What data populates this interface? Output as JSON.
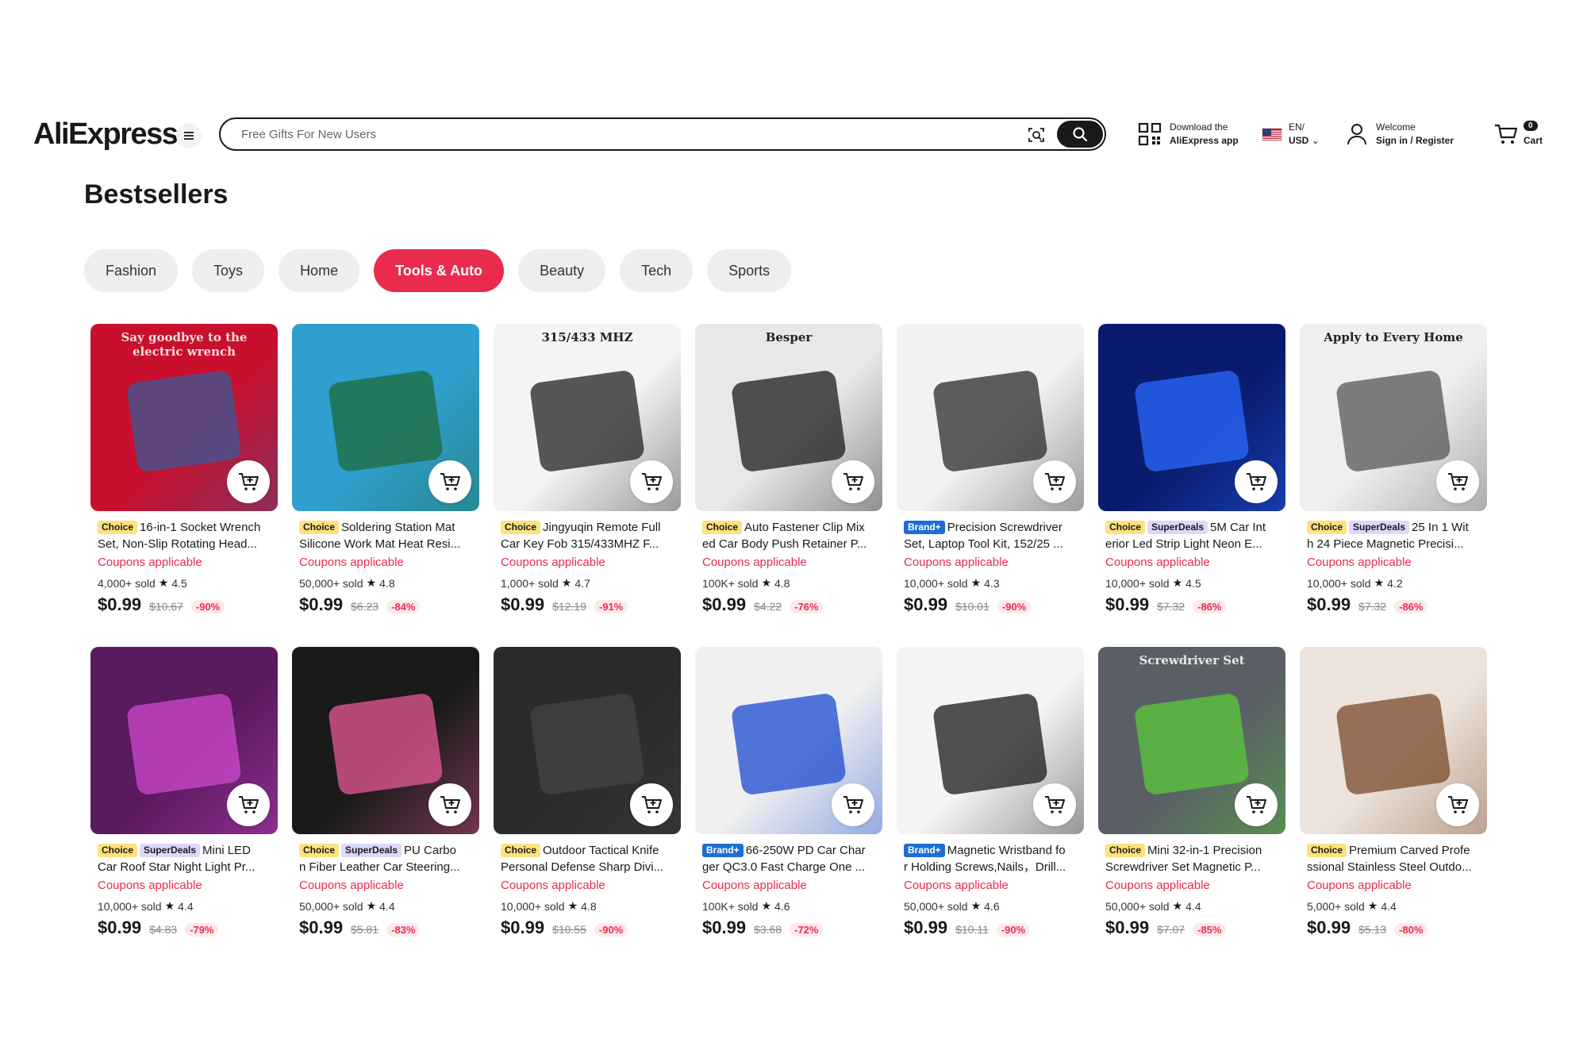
{
  "header": {
    "logo": "AliExpress",
    "search_placeholder": "Free Gifts For New Users",
    "app_line1": "Download the",
    "app_line2": "AliExpress app",
    "lang_line1": "EN/",
    "lang_line2": "USD",
    "user_line1": "Welcome",
    "user_line2": "Sign in / Register",
    "cart_count": "0",
    "cart_label": "Cart"
  },
  "page_title": "Bestsellers",
  "tabs": [
    {
      "label": "Fashion",
      "active": false
    },
    {
      "label": "Toys",
      "active": false
    },
    {
      "label": "Home",
      "active": false
    },
    {
      "label": "Tools & Auto",
      "active": true
    },
    {
      "label": "Beauty",
      "active": false
    },
    {
      "label": "Tech",
      "active": false
    },
    {
      "label": "Sports",
      "active": false
    }
  ],
  "products": [
    {
      "badges": [
        "Choice"
      ],
      "title1": "16-in-1 Socket Wrench",
      "title2": "Set, Non-Slip Rotating Head...",
      "coupon": "Coupons applicable",
      "sold": "4,000+ sold",
      "rating": "4.5",
      "price": "$0.99",
      "orig": "$10.67",
      "disc": "-90%",
      "bg": "#c8102e",
      "accent": "#3a5a9a",
      "thumb_text": "Say goodbye to the electric wrench"
    },
    {
      "badges": [
        "Choice"
      ],
      "title1": "Soldering Station Mat",
      "title2": "Silicone Work Mat Heat Resi...",
      "coupon": "Coupons applicable",
      "sold": "50,000+ sold",
      "rating": "4.8",
      "price": "$0.99",
      "orig": "$6.23",
      "disc": "-84%",
      "bg": "#2f9fd0",
      "accent": "#1f6b3a",
      "thumb_text": ""
    },
    {
      "badges": [
        "Choice"
      ],
      "title1": "Jingyuqin Remote Full",
      "title2": "Car Key Fob 315/433MHZ F...",
      "coupon": "Coupons applicable",
      "sold": "1,000+ sold",
      "rating": "4.7",
      "price": "$0.99",
      "orig": "$12.19",
      "disc": "-91%",
      "bg": "#f4f4f4",
      "accent": "#222222",
      "thumb_text": "315/433 MHZ"
    },
    {
      "badges": [
        "Choice"
      ],
      "title1": "Auto Fastener Clip Mix",
      "title2": "ed Car Body Push Retainer P...",
      "coupon": "Coupons applicable",
      "sold": "100K+ sold",
      "rating": "4.8",
      "price": "$0.99",
      "orig": "$4.22",
      "disc": "-76%",
      "bg": "#e8e8e8",
      "accent": "#1b1b1b",
      "thumb_text": "Besper"
    },
    {
      "badges": [
        "Brand+"
      ],
      "title1": "Precision Screwdriver",
      "title2": "Set, Laptop Tool Kit, 152/25 ...",
      "coupon": "Coupons applicable",
      "sold": "10,000+ sold",
      "rating": "4.3",
      "price": "$0.99",
      "orig": "$10.01",
      "disc": "-90%",
      "bg": "#f2f2f2",
      "accent": "#2a2a2a",
      "thumb_text": ""
    },
    {
      "badges": [
        "Choice",
        "SuperDeals"
      ],
      "title1": "5M Car Int",
      "title2": "erior Led Strip Light Neon E...",
      "coupon": "Coupons applicable",
      "sold": "10,000+ sold",
      "rating": "4.5",
      "price": "$0.99",
      "orig": "$7.32",
      "disc": "-86%",
      "bg": "#0a1a6e",
      "accent": "#2a6bff",
      "thumb_text": ""
    },
    {
      "badges": [
        "Choice",
        "SuperDeals"
      ],
      "title1": "25 In 1 Wit",
      "title2": "h 24 Piece Magnetic Precisi...",
      "coupon": "Coupons applicable",
      "sold": "10,000+ sold",
      "rating": "4.2",
      "price": "$0.99",
      "orig": "$7.32",
      "disc": "-86%",
      "bg": "#efefef",
      "accent": "#555555",
      "thumb_text": "Apply to Every Home"
    },
    {
      "badges": [
        "Choice",
        "SuperDeals"
      ],
      "title1": "Mini LED",
      "title2": "Car Roof Star Night Light Pr...",
      "coupon": "Coupons applicable",
      "sold": "10,000+ sold",
      "rating": "4.4",
      "price": "$0.99",
      "orig": "$4.83",
      "disc": "-79%",
      "bg": "#5a1a5e",
      "accent": "#d04ad0",
      "thumb_text": ""
    },
    {
      "badges": [
        "Choice",
        "SuperDeals"
      ],
      "title1": "PU Carbo",
      "title2": "n Fiber Leather Car Steering...",
      "coupon": "Coupons applicable",
      "sold": "50,000+ sold",
      "rating": "4.4",
      "price": "$0.99",
      "orig": "$5.81",
      "disc": "-83%",
      "bg": "#1a1a1a",
      "accent": "#e85a9a",
      "thumb_text": ""
    },
    {
      "badges": [
        "Choice"
      ],
      "title1": "Outdoor Tactical Knife",
      "title2": "Personal Defense Sharp Divi...",
      "coupon": "Coupons applicable",
      "sold": "10,000+ sold",
      "rating": "4.8",
      "price": "$0.99",
      "orig": "$10.55",
      "disc": "-90%",
      "bg": "#2b2b2b",
      "accent": "#444444",
      "thumb_text": ""
    },
    {
      "badges": [
        "Brand+"
      ],
      "title1": "66-250W PD Car Char",
      "title2": "ger QC3.0 Fast Charge One ...",
      "coupon": "Coupons applicable",
      "sold": "100K+ sold",
      "rating": "4.6",
      "price": "$0.99",
      "orig": "$3.68",
      "disc": "-72%",
      "bg": "#f0f0f0",
      "accent": "#1a4ad0",
      "thumb_text": ""
    },
    {
      "badges": [
        "Brand+"
      ],
      "title1": "Magnetic Wristband fo",
      "title2": "r Holding Screws,Nails，Drill...",
      "coupon": "Coupons applicable",
      "sold": "50,000+ sold",
      "rating": "4.6",
      "price": "$0.99",
      "orig": "$10.11",
      "disc": "-90%",
      "bg": "#f4f4f4",
      "accent": "#1a1a1a",
      "thumb_text": ""
    },
    {
      "badges": [
        "Choice"
      ],
      "title1": "Mini 32-in-1 Precision",
      "title2": "Screwdriver Set Magnetic P...",
      "coupon": "Coupons applicable",
      "sold": "50,000+ sold",
      "rating": "4.4",
      "price": "$0.99",
      "orig": "$7.07",
      "disc": "-85%",
      "bg": "#5a5f66",
      "accent": "#5ac83a",
      "thumb_text": "Screwdriver Set"
    },
    {
      "badges": [
        "Choice"
      ],
      "title1": "Premium Carved Profe",
      "title2": "ssional Stainless Steel Outdo...",
      "coupon": "Coupons applicable",
      "sold": "5,000+ sold",
      "rating": "4.4",
      "price": "$0.99",
      "orig": "$5.13",
      "disc": "-80%",
      "bg": "#ece4dc",
      "accent": "#7a4a2a",
      "thumb_text": ""
    }
  ]
}
